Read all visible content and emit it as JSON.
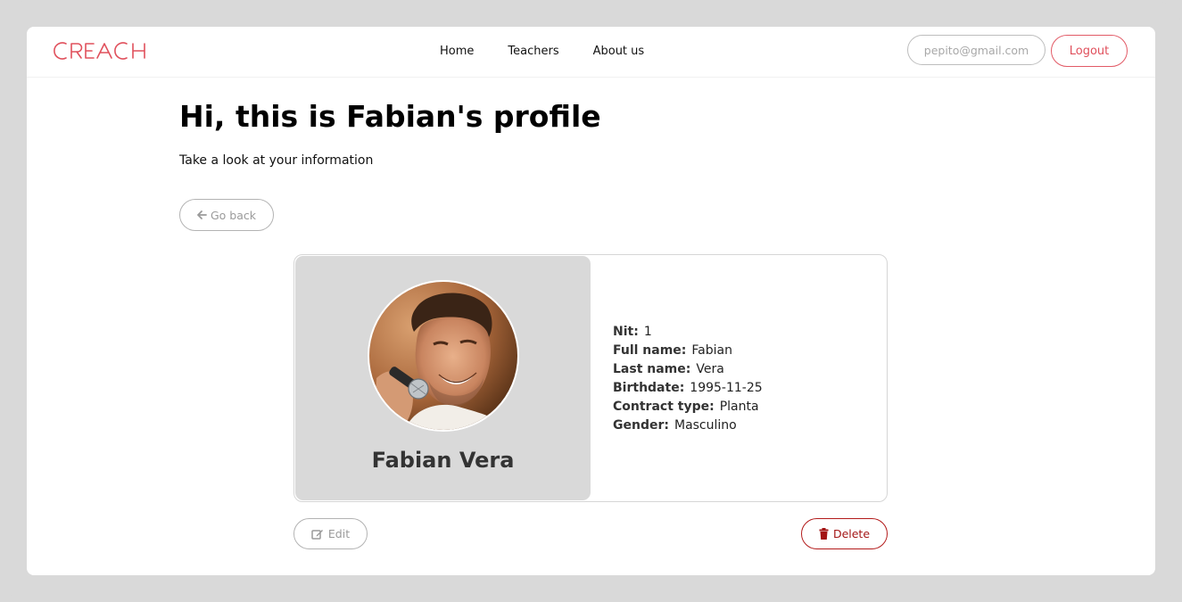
{
  "header": {
    "logo_text": "CREACH",
    "nav": [
      "Home",
      "Teachers",
      "About us"
    ],
    "user_email": "pepito@gmail.com",
    "logout_label": "Logout"
  },
  "main": {
    "title": "Hi, this is Fabian's profile",
    "subtitle": "Take a look at your information",
    "back_label": "Go back"
  },
  "profile": {
    "display_name": "Fabian Vera",
    "fields": [
      {
        "label": "Nit:",
        "value": "1"
      },
      {
        "label": "Full name:",
        "value": "Fabian"
      },
      {
        "label": "Last name:",
        "value": "Vera"
      },
      {
        "label": "Birthdate:",
        "value": "1995-11-25"
      },
      {
        "label": "Contract type:",
        "value": "Planta"
      },
      {
        "label": "Gender:",
        "value": "Masculino"
      }
    ]
  },
  "actions": {
    "edit_label": "Edit",
    "delete_label": "Delete"
  },
  "colors": {
    "brand": "#e0505c",
    "danger": "#a31515",
    "muted": "#9a9a9a",
    "panel": "#d9d9d9"
  }
}
